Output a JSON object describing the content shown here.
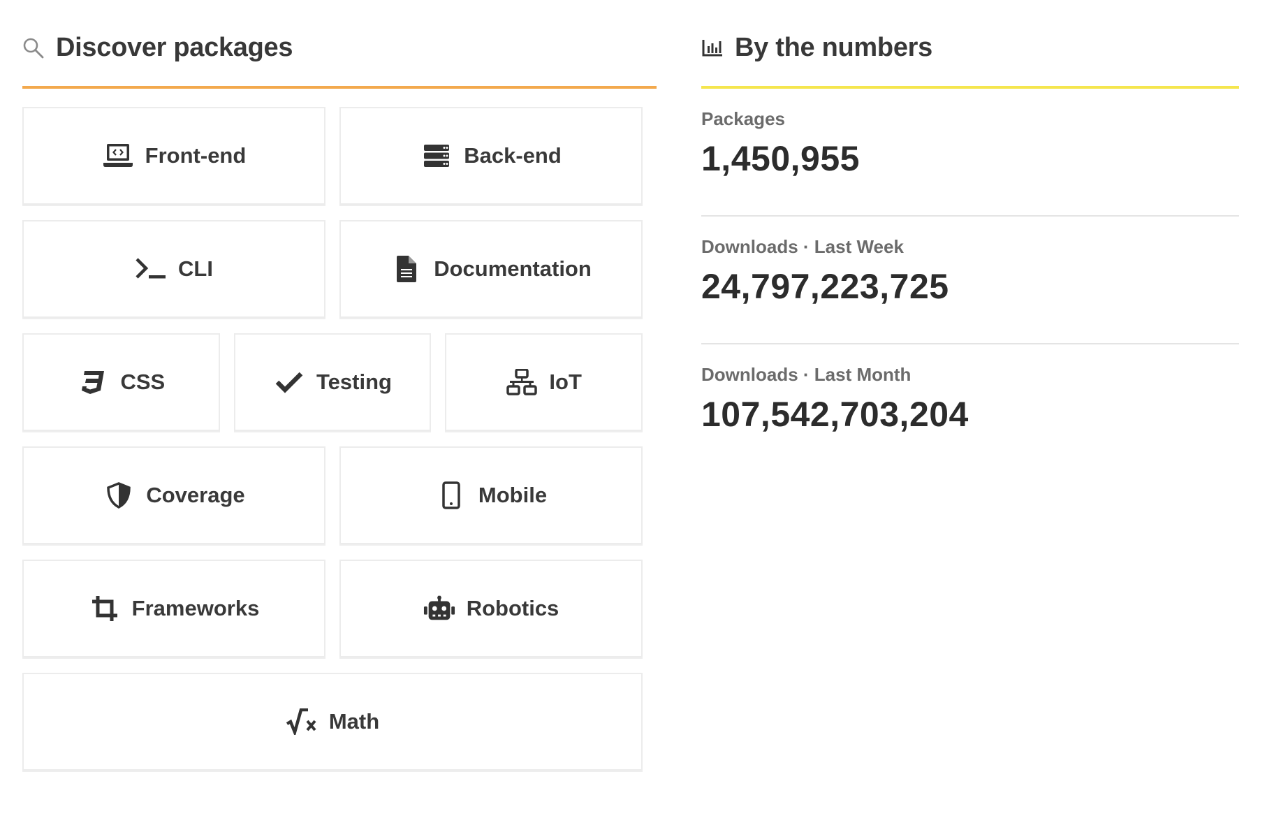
{
  "discover": {
    "title": "Discover packages",
    "icon": "search-icon",
    "accent": "#f3a94d",
    "tiles": [
      {
        "label": "Front-end",
        "icon": "laptop-code-icon"
      },
      {
        "label": "Back-end",
        "icon": "server-icon"
      },
      {
        "label": "CLI",
        "icon": "terminal-icon"
      },
      {
        "label": "Documentation",
        "icon": "document-icon"
      },
      {
        "label": "CSS",
        "icon": "css3-icon"
      },
      {
        "label": "Testing",
        "icon": "checkmark-icon"
      },
      {
        "label": "IoT",
        "icon": "network-icon"
      },
      {
        "label": "Coverage",
        "icon": "shield-icon"
      },
      {
        "label": "Mobile",
        "icon": "mobile-phone-icon"
      },
      {
        "label": "Frameworks",
        "icon": "crop-icon"
      },
      {
        "label": "Robotics",
        "icon": "robot-icon"
      },
      {
        "label": "Math",
        "icon": "square-root-icon"
      }
    ]
  },
  "numbers": {
    "title": "By the numbers",
    "icon": "bar-chart-icon",
    "accent": "#f5e64e",
    "stats": [
      {
        "label": "Packages",
        "value": "1,450,955"
      },
      {
        "label": "Downloads · Last Week",
        "value": "24,797,223,725"
      },
      {
        "label": "Downloads · Last Month",
        "value": "107,542,703,204"
      }
    ]
  }
}
